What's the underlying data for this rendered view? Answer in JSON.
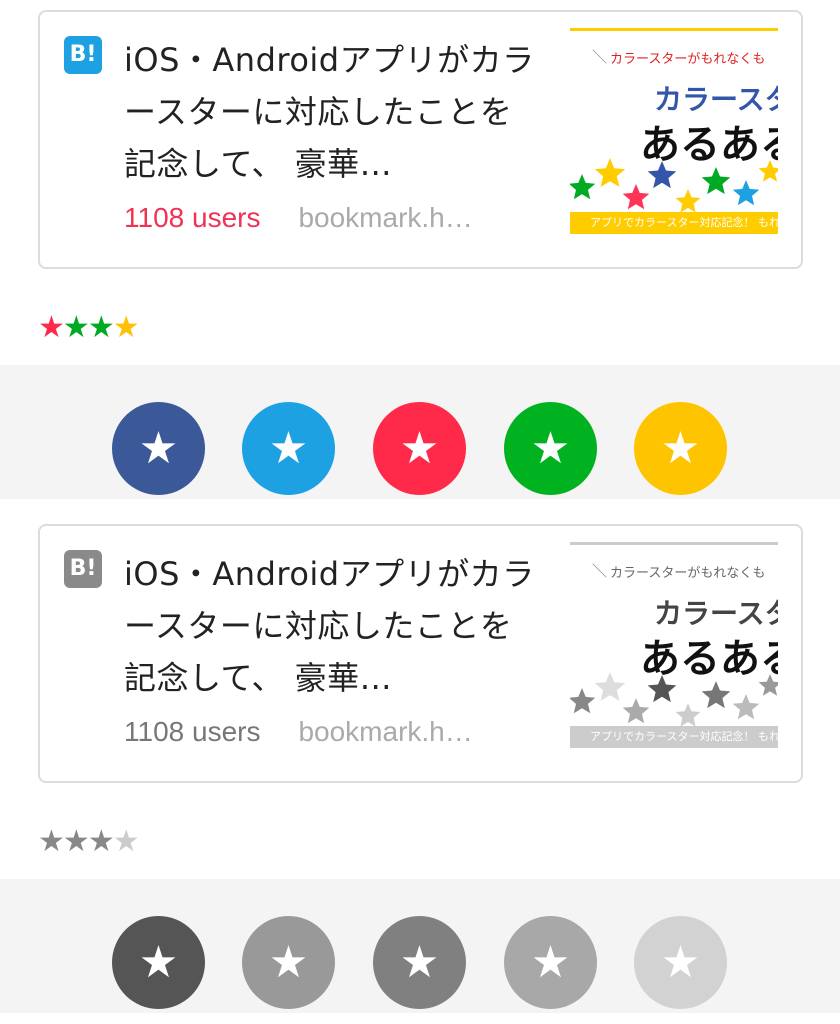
{
  "entries": [
    {
      "logo_text": "B!",
      "logo_color": "#1da1e2",
      "title": "iOS・Androidアプリがカラースターに対応したことを記念して、 豪華…",
      "users": "1108 users",
      "users_color": "#ee3355",
      "domain": "bookmark.h…",
      "thumb": {
        "tag": "カラースターがもれなくも",
        "headline": "カラースタ",
        "big": "あるある",
        "footer": "アプリでカラースター対応記念！ もれなくカラー",
        "accent": "#ffcc00",
        "tag_color": "#e02020",
        "headline_color": "#3355aa",
        "star_colors": [
          "#00aa22",
          "#ffcc00",
          "#ff3355",
          "#3355aa",
          "#ffcc00",
          "#00aa22",
          "#1da1e2",
          "#ffcc00"
        ]
      },
      "mini_stars": [
        {
          "glyph": "★",
          "color": "#ff2a4a"
        },
        {
          "glyph": "★",
          "color": "#00aa22"
        },
        {
          "glyph": "★",
          "color": "#00aa22"
        },
        {
          "glyph": "★",
          "color": "#ffc107"
        }
      ],
      "buttons": [
        {
          "glyph": "★",
          "color": "#3b5998",
          "icon": "star-icon"
        },
        {
          "glyph": "★",
          "color": "#1da1e2",
          "icon": "star-icon"
        },
        {
          "glyph": "★",
          "color": "#ff2a4a",
          "icon": "star-icon"
        },
        {
          "glyph": "★",
          "color": "#00b21f",
          "icon": "star-icon"
        },
        {
          "glyph": "★",
          "color": "#ffc400",
          "icon": "star-icon"
        }
      ]
    },
    {
      "logo_text": "B!",
      "logo_color": "#8a8a8a",
      "title": "iOS・Androidアプリがカラースターに対応したことを記念して、 豪華…",
      "users": "1108 users",
      "users_color": "#777777",
      "domain": "bookmark.h…",
      "thumb": {
        "tag": "カラースターがもれなくも",
        "headline": "カラースタ",
        "big": "あるある",
        "footer": "アプリでカラースター対応記念！ もれなくカラー",
        "accent": "#cccccc",
        "tag_color": "#666666",
        "headline_color": "#444444",
        "star_colors": [
          "#888888",
          "#dddddd",
          "#aaaaaa",
          "#555555",
          "#cccccc",
          "#777777",
          "#bbbbbb",
          "#999999"
        ]
      },
      "mini_stars": [
        {
          "glyph": "★",
          "color": "#888888"
        },
        {
          "glyph": "★",
          "color": "#888888"
        },
        {
          "glyph": "★",
          "color": "#888888"
        },
        {
          "glyph": "★",
          "color": "#cccccc"
        }
      ],
      "buttons": [
        {
          "glyph": "★",
          "color": "#555555",
          "icon": "star-icon"
        },
        {
          "glyph": "★",
          "color": "#999999",
          "icon": "star-icon"
        },
        {
          "glyph": "★",
          "color": "#808080",
          "icon": "star-icon"
        },
        {
          "glyph": "★",
          "color": "#a8a8a8",
          "icon": "star-icon"
        },
        {
          "glyph": "★",
          "color": "#d2d2d2",
          "icon": "star-icon"
        }
      ]
    }
  ]
}
